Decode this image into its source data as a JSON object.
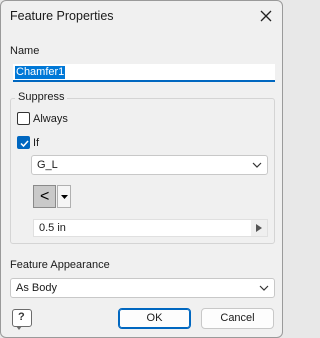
{
  "dialog": {
    "title": "Feature Properties",
    "close_icon": "close-icon"
  },
  "name": {
    "label": "Name",
    "value": "Chamfer1"
  },
  "suppress": {
    "legend": "Suppress",
    "always": {
      "label": "Always",
      "checked": false
    },
    "if": {
      "label": "If",
      "checked": true
    },
    "parameter": {
      "selected": "G_L"
    },
    "operator": {
      "symbol": "<"
    },
    "value": {
      "text": "0.5 in"
    }
  },
  "appearance": {
    "label": "Feature Appearance",
    "selected": "As Body"
  },
  "buttons": {
    "help_icon": "help-icon",
    "ok": "OK",
    "cancel": "Cancel"
  },
  "colors": {
    "accent": "#0067c0",
    "selection": "#0078d7"
  }
}
